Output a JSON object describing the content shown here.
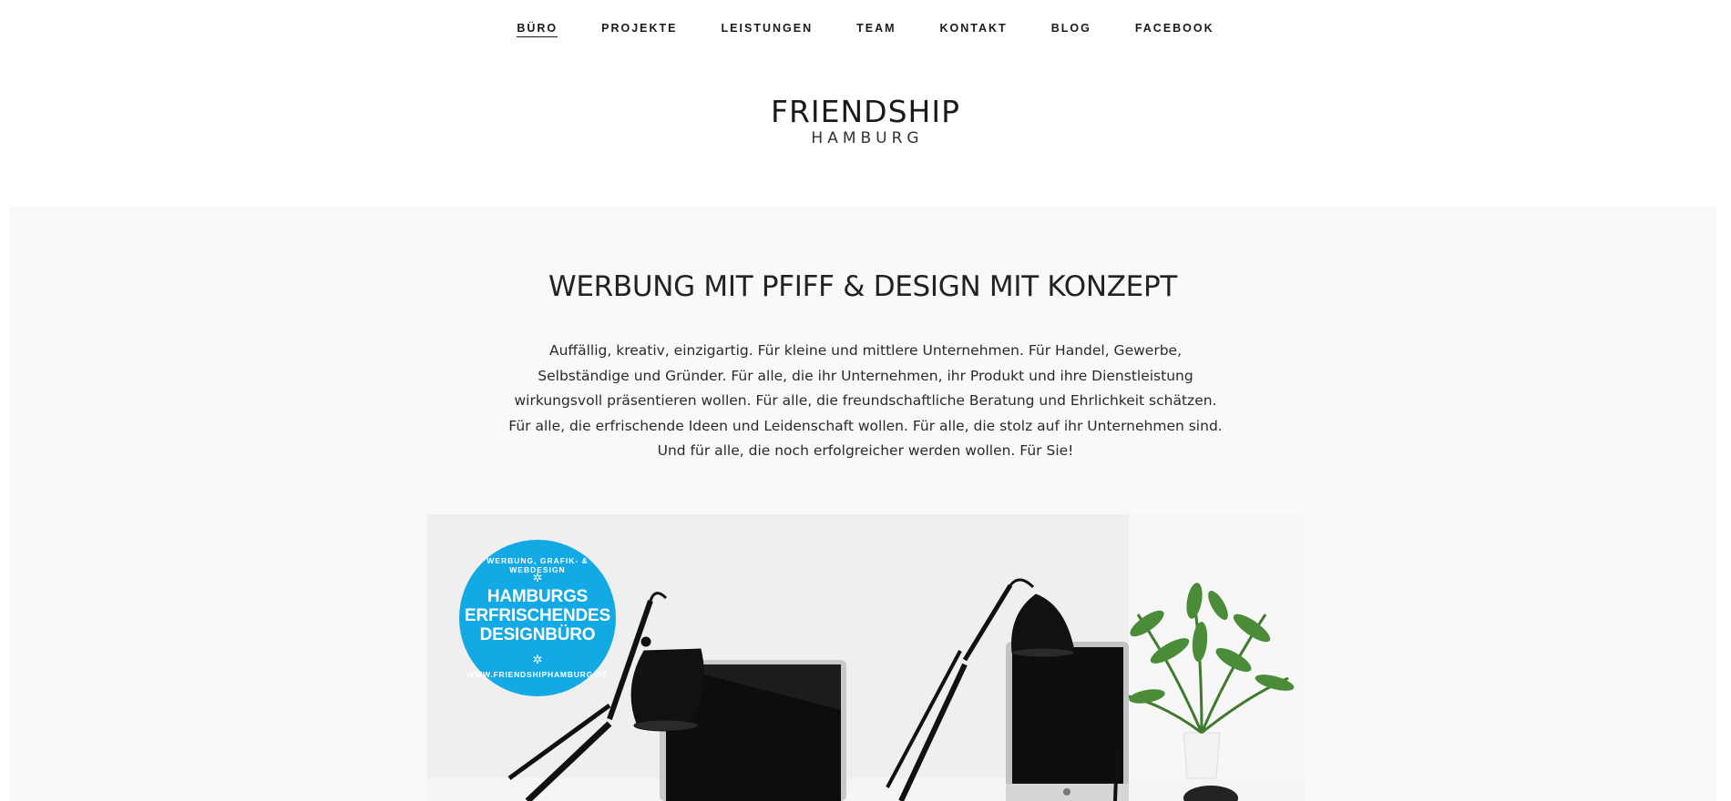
{
  "nav": {
    "items": [
      {
        "label": "BÜRO",
        "active": true
      },
      {
        "label": "PROJEKTE",
        "active": false
      },
      {
        "label": "LEISTUNGEN",
        "active": false
      },
      {
        "label": "TEAM",
        "active": false
      },
      {
        "label": "KONTAKT",
        "active": false
      },
      {
        "label": "BLOG",
        "active": false
      },
      {
        "label": "FACEBOOK",
        "active": false
      }
    ]
  },
  "logo": {
    "main": "FRIENDSHIP",
    "sub": "HAMBURG"
  },
  "main": {
    "headline": "WERBUNG MIT PFIFF & DESIGN MIT KONZEPT",
    "intro": "Auffällig, kreativ, einzigartig. Für kleine und mittlere Unternehmen. Für Handel, Gewerbe, Selbständige und Gründer. Für alle, die ihr Unternehmen, ihr Produkt und ihre Dienstleistung wirkungsvoll präsentieren wollen. Für alle, die freundschaftliche Beratung und Ehrlichkeit schätzen. Für alle, die erfrischende Ideen und Leidenschaft wollen. Für alle, die stolz auf ihr Unternehmen sind. Und für alle, die noch erfolgreicher werden wollen. Für Sie!"
  },
  "hero": {
    "badge": {
      "top": "WERBUNG, GRAFIK- & WEBDESIGN",
      "line1": "HAMBURGS",
      "line2": "ERFRISCHENDES",
      "line3": "DESIGNBÜRO",
      "bottom": "WWW.FRIENDSHIPHAMBURG.DE",
      "star": "✲"
    }
  },
  "colors": {
    "badge": "#12a9e4",
    "content_bg": "#f9f9f9",
    "text": "#222222"
  }
}
